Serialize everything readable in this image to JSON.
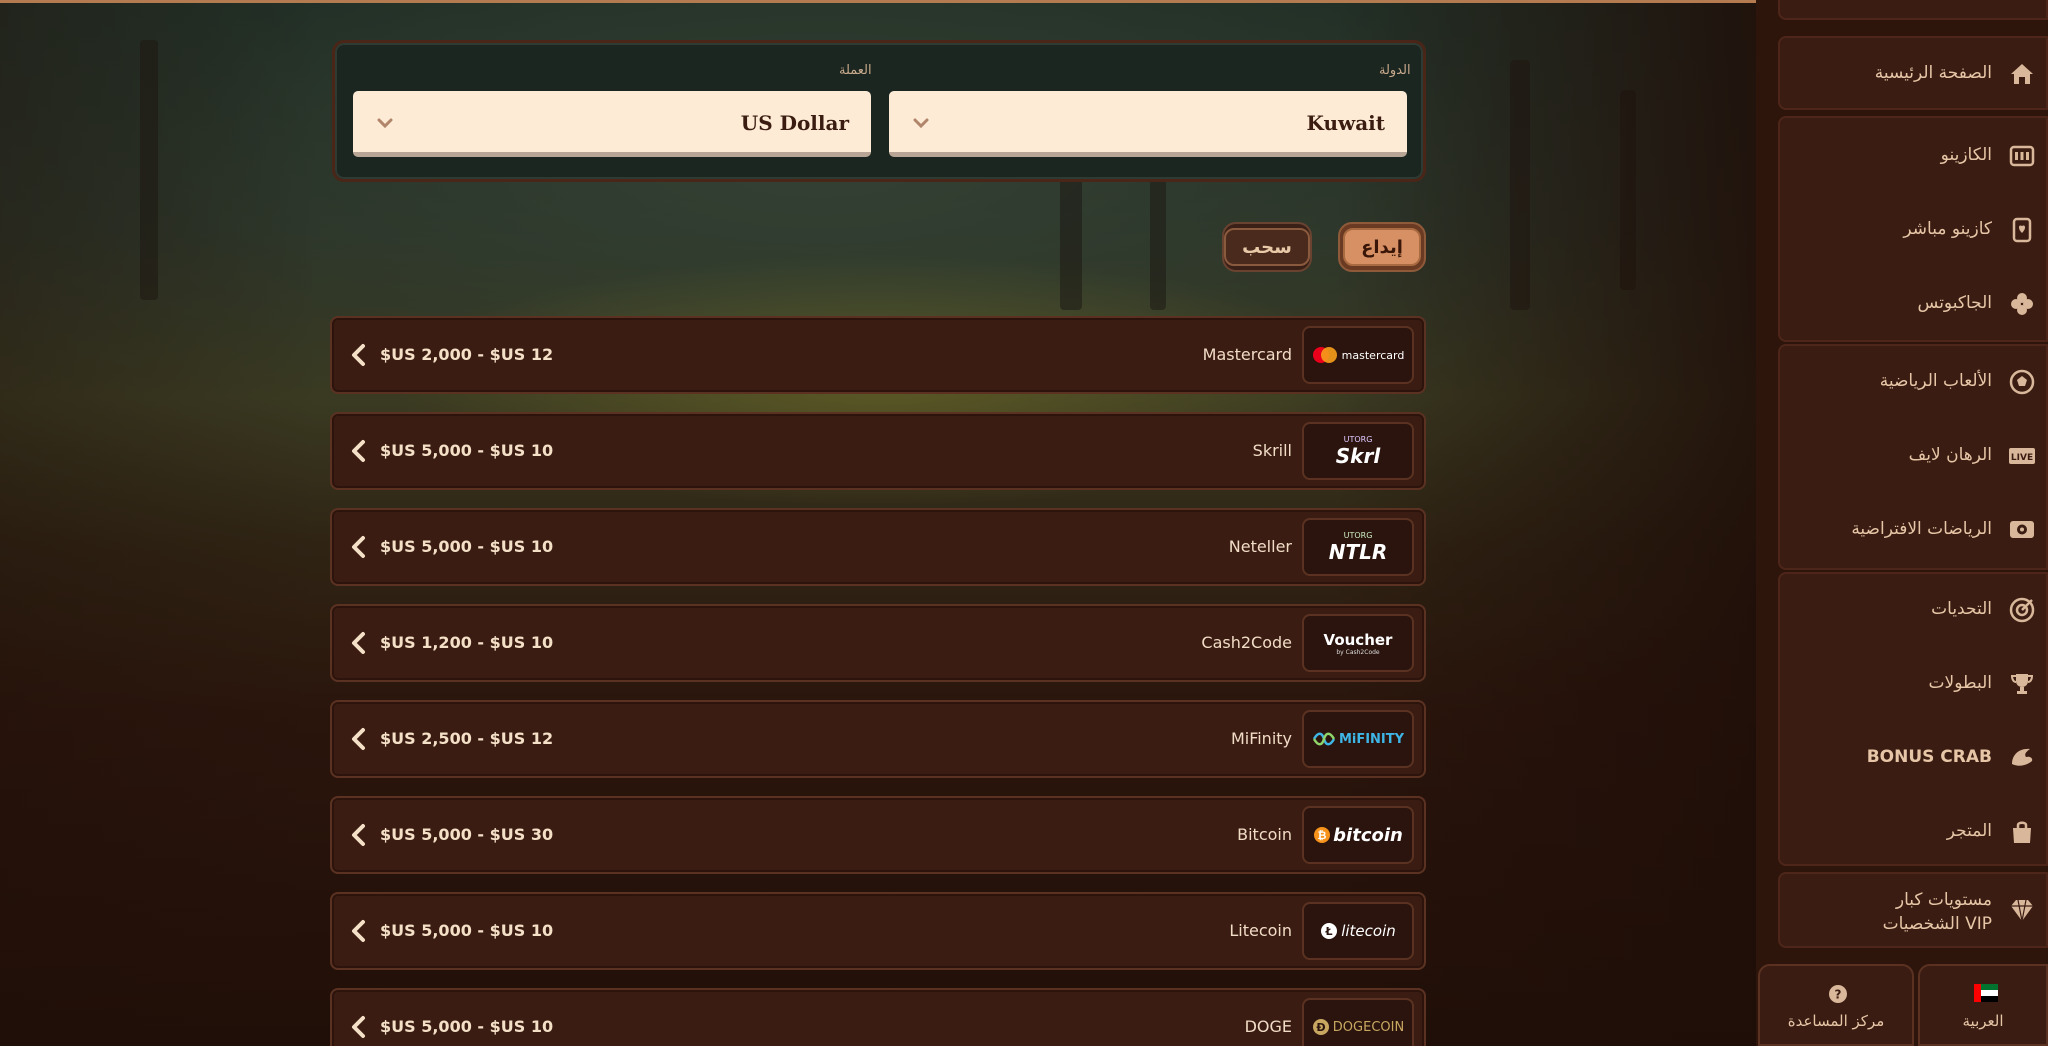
{
  "country_field": {
    "label": "الدولة",
    "value": "Kuwait"
  },
  "currency_field": {
    "label": "العملة",
    "value": "US Dollar"
  },
  "tabs": {
    "deposit": "إيداع",
    "withdraw": "سحب"
  },
  "payment_methods": [
    {
      "name": "Mastercard",
      "range": "$US 2,000 - $US 12",
      "logo_text": "mastercard"
    },
    {
      "name": "Skrill",
      "range": "$US 5,000 - $US 10",
      "logo_text": "Skrl",
      "logo_sub": "UTORG"
    },
    {
      "name": "Neteller",
      "range": "$US 5,000 - $US 10",
      "logo_text": "NTLR",
      "logo_sub": "UTORG"
    },
    {
      "name": "Cash2Code",
      "range": "$US 1,200 - $US 10",
      "logo_text": "Voucher",
      "logo_sub": "by Cash2Code"
    },
    {
      "name": "MiFinity",
      "range": "$US 2,500 - $US 12",
      "logo_text": "MiFINITY"
    },
    {
      "name": "Bitcoin",
      "range": "$US 5,000 - $US 30",
      "logo_text": "bitcoin"
    },
    {
      "name": "Litecoin",
      "range": "$US 5,000 - $US 10",
      "logo_text": "litecoin"
    },
    {
      "name": "DOGE",
      "range": "$US 5,000 - $US 10",
      "logo_text": "DOGECOIN"
    }
  ],
  "sidebar": {
    "items": [
      {
        "label": "الصفحة الرئيسية",
        "icon": "home-icon"
      },
      {
        "label": "الكازينو",
        "icon": "slot-machine-icon"
      },
      {
        "label": "كازينو مباشر",
        "icon": "cards-icon"
      },
      {
        "label": "الجاكبوتس",
        "icon": "clover-icon"
      },
      {
        "label": "الألعاب الرياضية",
        "icon": "soccer-ball-icon"
      },
      {
        "label": "الرهان لايف",
        "icon": "live-icon",
        "badge": "LIVE"
      },
      {
        "label": "الرياضات الافتراضية",
        "icon": "virtual-sports-icon"
      },
      {
        "label": "التحديات",
        "icon": "target-icon"
      },
      {
        "label": "البطولات",
        "icon": "trophy-icon"
      },
      {
        "label": "BONUS CRAB",
        "icon": "crab-claw-icon"
      },
      {
        "label": "المتجر",
        "icon": "shopping-bag-icon"
      },
      {
        "label": "مستويات كبار الشخصيات VIP",
        "label_line1": "مستويات كبار",
        "label_line2": "الشخصيات VIP",
        "icon": "diamond-icon"
      }
    ],
    "language_button": "العربية",
    "help_button": "مركز المساعدة"
  },
  "colors": {
    "accent": "#d79063",
    "panel": "#3a1c12",
    "border": "#5b3222",
    "text": "#f1dcc6"
  }
}
